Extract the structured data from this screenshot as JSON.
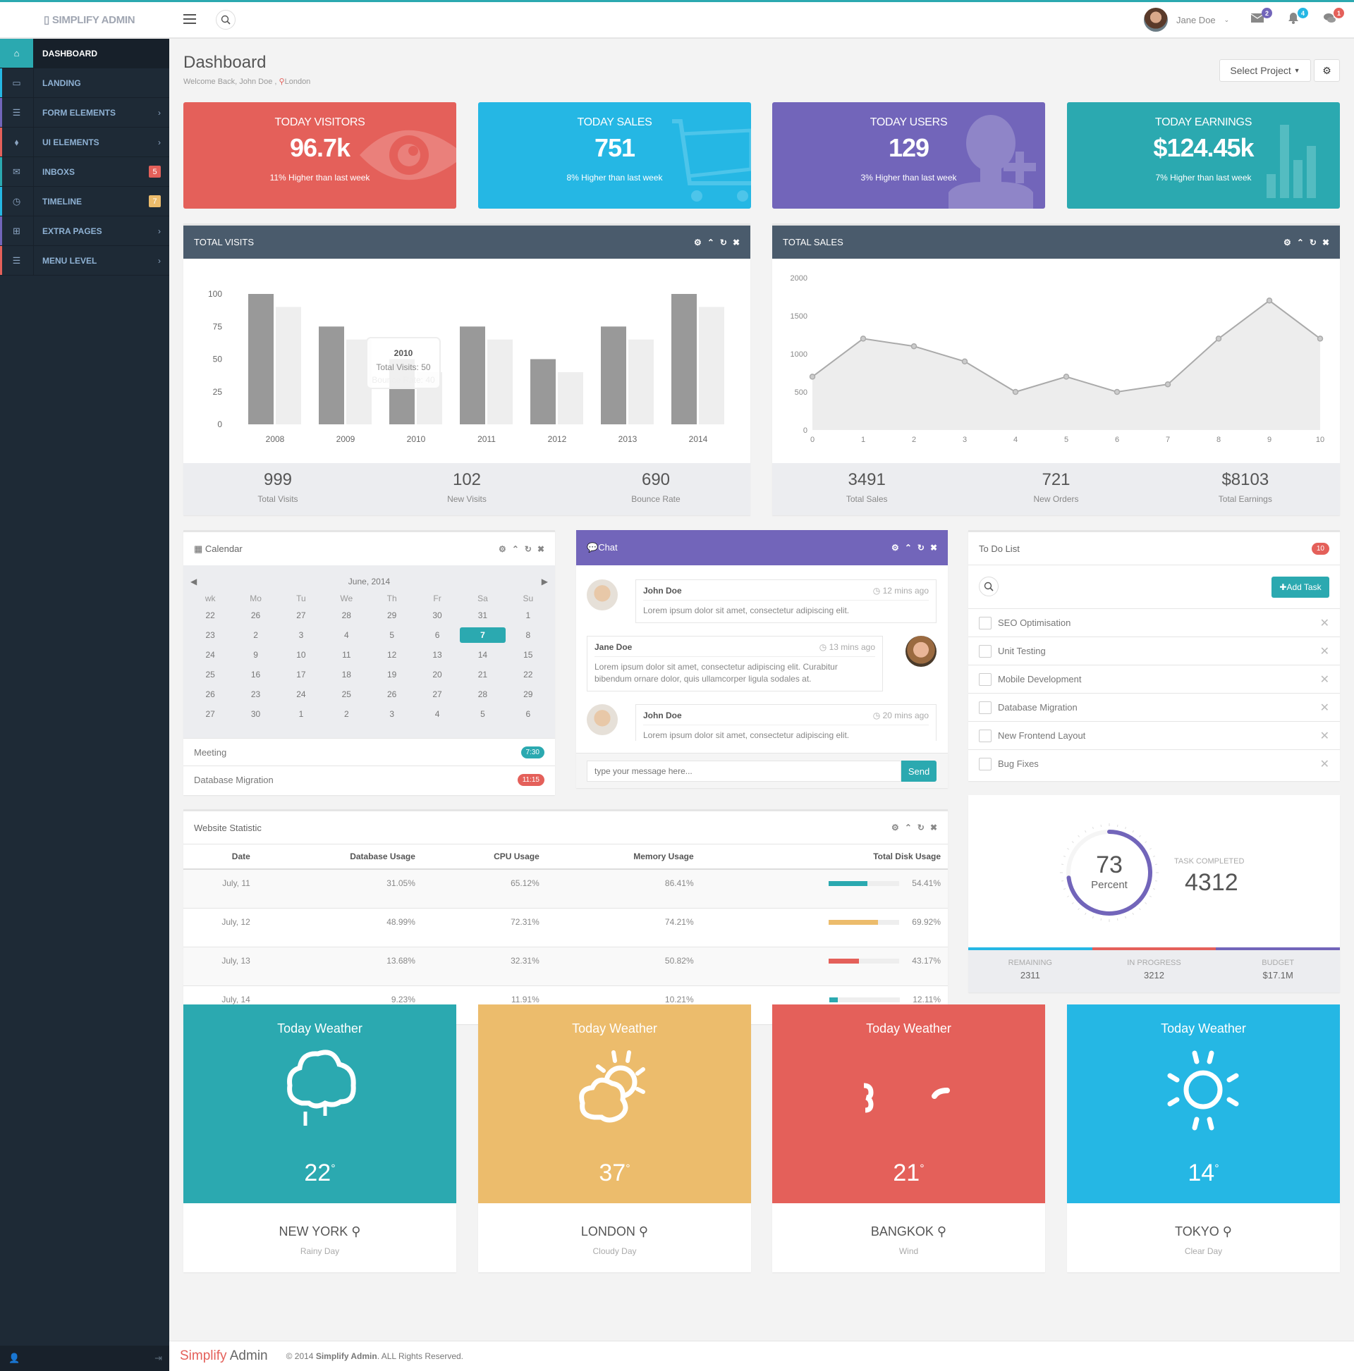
{
  "app": {
    "brand": "SIMPLIFY ADMIN",
    "brand_icon": "logo-glyph"
  },
  "topbar": {
    "user_name": "Jane Doe",
    "messages_count": "2",
    "notifications_count": "4",
    "chats_count": "1"
  },
  "sidebar": {
    "items": [
      {
        "label": "DASHBOARD",
        "icon": "home-icon",
        "active": true
      },
      {
        "label": "LANDING",
        "icon": "desktop-icon"
      },
      {
        "label": "FORM ELEMENTS",
        "icon": "list-icon",
        "chevron": "›"
      },
      {
        "label": "UI ELEMENTS",
        "icon": "tags-icon",
        "chevron": "›"
      },
      {
        "label": "INBOXS",
        "icon": "envelope-icon",
        "badge": "5"
      },
      {
        "label": "TIMELINE",
        "icon": "clock-icon",
        "badge": "7"
      },
      {
        "label": "EXTRA PAGES",
        "icon": "gift-icon",
        "chevron": "›"
      },
      {
        "label": "MENU LEVEL",
        "icon": "list-icon",
        "chevron": "›"
      }
    ]
  },
  "page": {
    "title": "Dashboard",
    "welcome": "Welcome Back, John Doe ,",
    "location": "London",
    "select_project": "Select Project"
  },
  "stats": [
    {
      "title": "TODAY VISITORS",
      "value": "96.7k",
      "footer": "11% Higher than last week"
    },
    {
      "title": "TODAY SALES",
      "value": "751",
      "footer": "8% Higher than last week"
    },
    {
      "title": "TODAY USERS",
      "value": "129",
      "footer": "3% Higher than last week"
    },
    {
      "title": "TODAY EARNINGS",
      "value": "$124.45k",
      "footer": "7% Higher than last week"
    }
  ],
  "colors": {
    "red": "#e4605a",
    "blue": "#25b7e4",
    "purple": "#7265ba",
    "teal": "#2ba9b0",
    "yellow": "#ecbc6c",
    "dark": "#1e2a36"
  },
  "total_visits": {
    "title": "TOTAL VISITS",
    "tooltip": {
      "title": "2010",
      "line1": "Total Visits: 50",
      "line2": "Bounce Rate: 40"
    },
    "summary": [
      {
        "value": "999",
        "label": "Total Visits"
      },
      {
        "value": "102",
        "label": "New Visits"
      },
      {
        "value": "690",
        "label": "Bounce Rate"
      }
    ]
  },
  "total_sales": {
    "title": "TOTAL SALES",
    "summary": [
      {
        "value": "3491",
        "label": "Total Sales"
      },
      {
        "value": "721",
        "label": "New Orders"
      },
      {
        "value": "$8103",
        "label": "Total Earnings"
      }
    ]
  },
  "chart_data": [
    {
      "type": "bar",
      "title": "TOTAL VISITS",
      "categories": [
        "2008",
        "2009",
        "2010",
        "2011",
        "2012",
        "2013",
        "2014"
      ],
      "series": [
        {
          "name": "Total Visits",
          "values": [
            100,
            75,
            50,
            75,
            50,
            75,
            100
          ]
        },
        {
          "name": "Bounce Rate",
          "values": [
            90,
            65,
            40,
            65,
            40,
            65,
            90
          ]
        }
      ],
      "yticks": [
        0,
        25,
        50,
        75,
        100
      ],
      "ylim": [
        0,
        100
      ],
      "grid": false
    },
    {
      "type": "area",
      "title": "TOTAL SALES",
      "x": [
        0,
        1,
        2,
        3,
        4,
        5,
        6,
        7,
        8,
        9,
        10
      ],
      "series": [
        {
          "name": "Sales",
          "values": [
            700,
            1200,
            1100,
            900,
            500,
            700,
            500,
            600,
            1200,
            1700,
            1200
          ]
        }
      ],
      "yticks": [
        0,
        500,
        1000,
        1500,
        2000
      ],
      "ylim": [
        0,
        2000
      ],
      "xlim": [
        0,
        10
      ],
      "grid": false
    }
  ],
  "calendar": {
    "title": "Calendar",
    "month": "June, 2014",
    "headers": [
      "wk",
      "Mo",
      "Tu",
      "We",
      "Th",
      "Fr",
      "Sa",
      "Su"
    ],
    "rows": [
      [
        "22",
        "26",
        "27",
        "28",
        "29",
        "30",
        "31",
        "1"
      ],
      [
        "23",
        "2",
        "3",
        "4",
        "5",
        "6",
        "7",
        "8"
      ],
      [
        "24",
        "9",
        "10",
        "11",
        "12",
        "13",
        "14",
        "15"
      ],
      [
        "25",
        "16",
        "17",
        "18",
        "19",
        "20",
        "21",
        "22"
      ],
      [
        "26",
        "23",
        "24",
        "25",
        "26",
        "27",
        "28",
        "29"
      ],
      [
        "27",
        "30",
        "1",
        "2",
        "3",
        "4",
        "5",
        "6"
      ]
    ],
    "selected": "7",
    "events": [
      {
        "label": "Meeting",
        "time": "7:30"
      },
      {
        "label": "Database Migration",
        "time": "11:15"
      }
    ]
  },
  "chat": {
    "title": "Chat",
    "messages": [
      {
        "name": "John Doe",
        "time": "12 mins ago",
        "text": "Lorem ipsum dolor sit amet, consectetur adipiscing elit."
      },
      {
        "name": "Jane Doe",
        "time": "13 mins ago",
        "text": "Lorem ipsum dolor sit amet, consectetur adipiscing elit. Curabitur bibendum ornare dolor, quis ullamcorper ligula sodales at."
      },
      {
        "name": "John Doe",
        "time": "20 mins ago",
        "text": "Lorem ipsum dolor sit amet, consectetur adipiscing elit."
      }
    ],
    "placeholder": "type your message here...",
    "send": "Send"
  },
  "todo": {
    "title": "To Do List",
    "count": "10",
    "add_label": "Add Task",
    "items": [
      "SEO Optimisation",
      "Unit Testing",
      "Mobile Development",
      "Database Migration",
      "New Frontend Layout",
      "Bug Fixes"
    ]
  },
  "website_stat": {
    "title": "Website Statistic",
    "headers": [
      "Date",
      "Database Usage",
      "CPU Usage",
      "Memory Usage",
      "Total Disk Usage"
    ],
    "rows": [
      {
        "date": "July, 11",
        "db": "31.05%",
        "cpu": "65.12%",
        "mem": "86.41%",
        "disk": "54.41%",
        "disk_pct": 54.41,
        "color": "#2ba9b0"
      },
      {
        "date": "July, 12",
        "db": "48.99%",
        "cpu": "72.31%",
        "mem": "74.21%",
        "disk": "69.92%",
        "disk_pct": 69.92,
        "color": "#ecbc6c"
      },
      {
        "date": "July, 13",
        "db": "13.68%",
        "cpu": "32.31%",
        "mem": "50.82%",
        "disk": "43.17%",
        "disk_pct": 43.17,
        "color": "#e4605a"
      },
      {
        "date": "July, 14",
        "db": "9.23%",
        "cpu": "11.91%",
        "mem": "10.21%",
        "disk": "12.11%",
        "disk_pct": 12.11,
        "color": "#2ba9b0"
      }
    ]
  },
  "task": {
    "percent": "73",
    "percent_value": 73,
    "percent_label": "Percent",
    "completed_label": "TASK COMPLETED",
    "completed": "4312",
    "stats": [
      {
        "label": "REMAINING",
        "value": "2311"
      },
      {
        "label": "IN PROGRESS",
        "value": "3212"
      },
      {
        "label": "BUDGET",
        "value": "$17.1M"
      }
    ]
  },
  "weather": [
    {
      "title": "Today Weather",
      "temp": "22",
      "city": "NEW YORK",
      "desc": "Rainy Day",
      "icon": "rain-cloud-icon"
    },
    {
      "title": "Today Weather",
      "temp": "37",
      "city": "LONDON",
      "desc": "Cloudy Day",
      "icon": "partly-cloudy-icon"
    },
    {
      "title": "Today Weather",
      "temp": "21",
      "city": "BANGKOK",
      "desc": "Wind",
      "icon": "wind-icon"
    },
    {
      "title": "Today Weather",
      "temp": "14",
      "city": "TOKYO",
      "desc": "Clear Day",
      "icon": "sun-icon"
    }
  ],
  "footer": {
    "brand_a": "Simplify",
    "brand_b": "Admin",
    "copy_a": "© 2014",
    "copy_b": "Simplify Admin",
    "copy_c": ". ALL Rights Reserved."
  }
}
